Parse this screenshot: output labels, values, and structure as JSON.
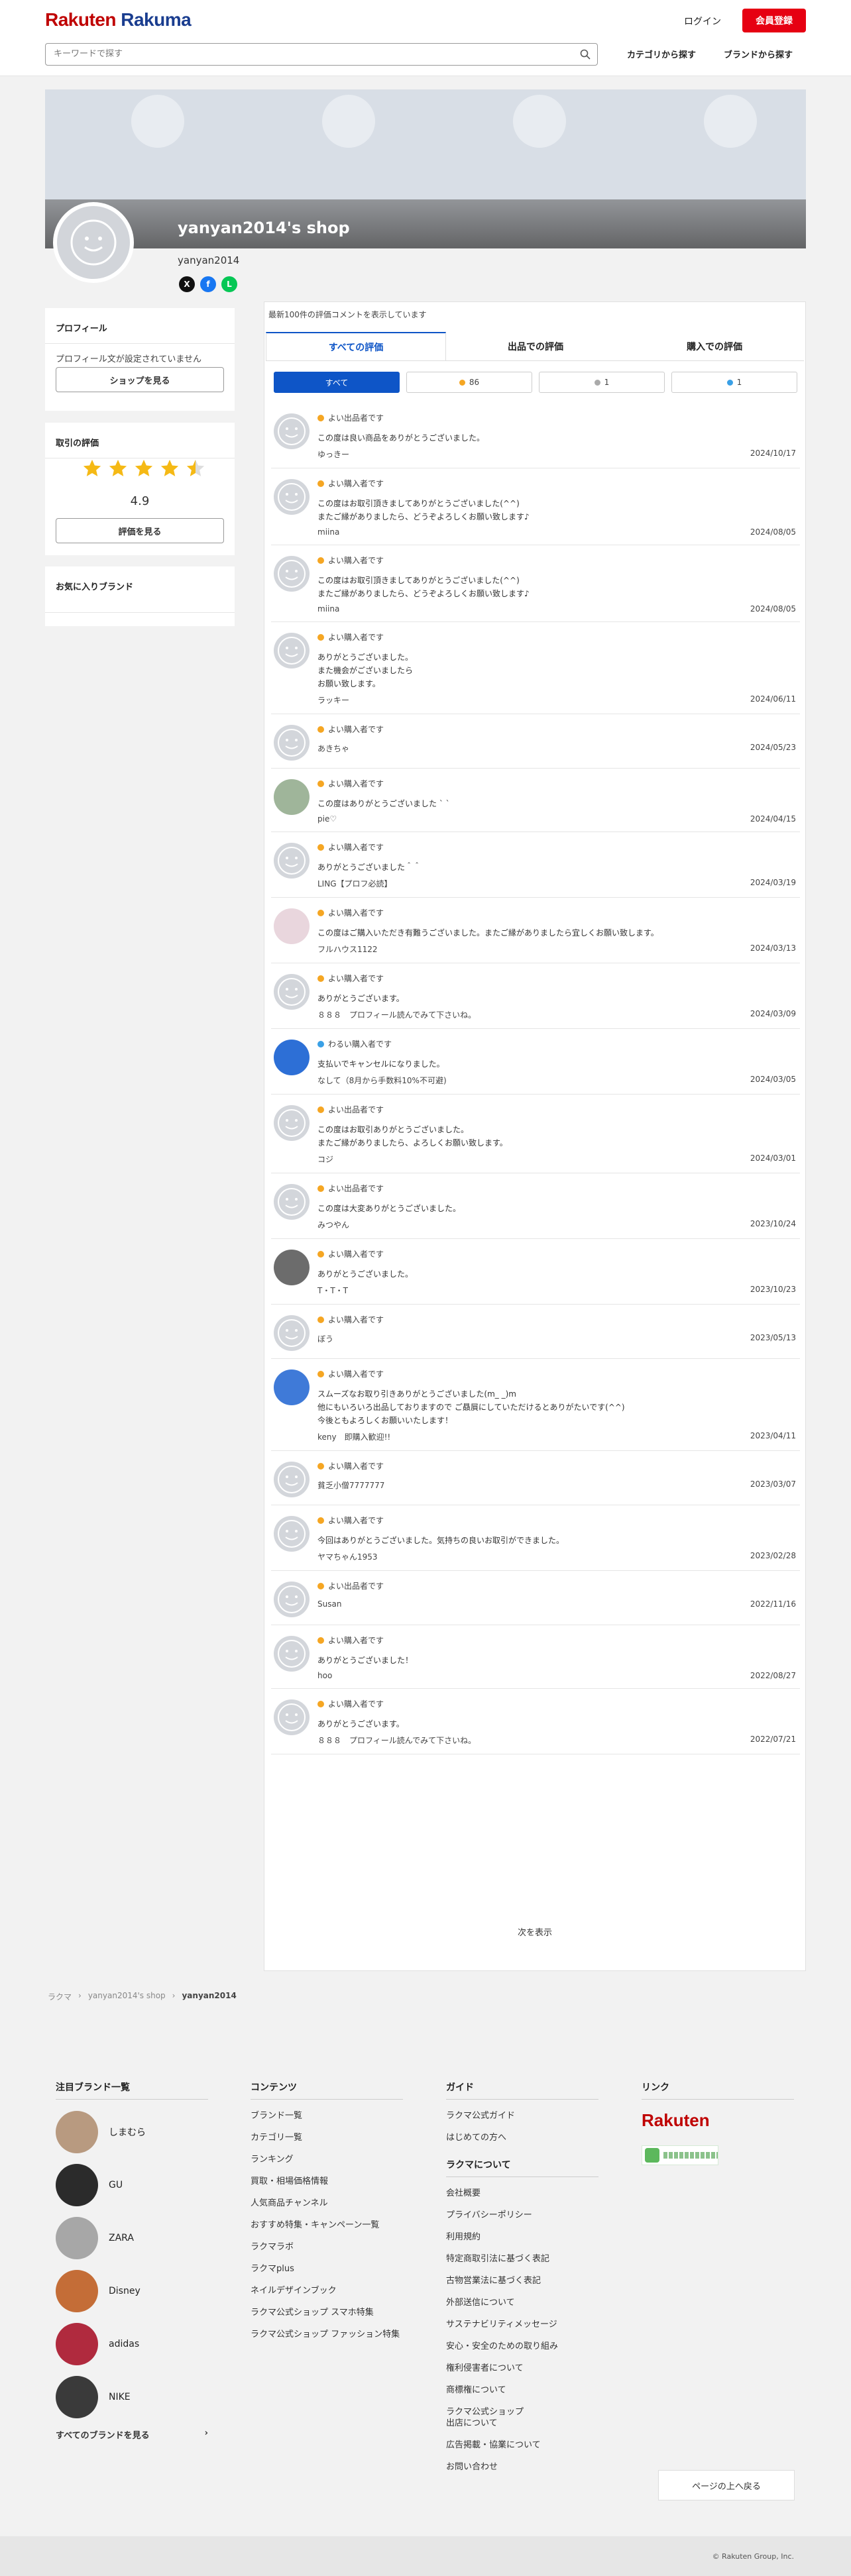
{
  "header": {
    "logo_rakuten": "Rakuten",
    "logo_rakuma": "Rakuma",
    "login": "ログイン",
    "signup": "会員登録",
    "search_placeholder": "キーワードで探す",
    "nav_category": "カテゴリから探す",
    "nav_brand": "ブランドから探す"
  },
  "shop": {
    "name": "yanyan2014's shop",
    "username": "yanyan2014"
  },
  "sidebar": {
    "profile_title": "プロフィール",
    "profile_text": "プロフィール文が設定されていません",
    "shop_button": "ショップを見る",
    "rating_title": "取引の評価",
    "rating_value": "4.9",
    "rating_stars": 4.5,
    "rating_button": "評価を見る",
    "fav_brand_title": "お気に入りブランド"
  },
  "main": {
    "note": "最新100件の評価コメントを表示しています",
    "tabs": [
      "すべての評価",
      "出品での評価",
      "購入での評価"
    ],
    "filters": {
      "all": "すべて",
      "good": "86",
      "normal": "1",
      "bad": "1"
    },
    "more": "次を表示"
  },
  "reviews": [
    {
      "type": "よい出品者です",
      "text": "この度は良い商品をありがとうございました。",
      "user": "ゆっきー",
      "date": "2024/10/17",
      "kind": "good"
    },
    {
      "type": "よい購入者です",
      "text": "この度はお取引頂きましてありがとうございました(^^)\nまたご縁がありましたら、どうぞよろしくお願い致します♪",
      "user": "miina",
      "date": "2024/08/05",
      "kind": "good"
    },
    {
      "type": "よい購入者です",
      "text": "この度はお取引頂きましてありがとうございました(^^)\nまたご縁がありましたら、どうぞよろしくお願い致します♪",
      "user": "miina",
      "date": "2024/08/05",
      "kind": "good"
    },
    {
      "type": "よい購入者です",
      "text": "ありがとうございました。\nまた機会がございましたら\nお願い致します。",
      "user": "ラッキー",
      "date": "2024/06/11",
      "kind": "good"
    },
    {
      "type": "よい購入者です",
      "text": "",
      "user": "あきちゃ",
      "date": "2024/05/23",
      "kind": "good"
    },
    {
      "type": "よい購入者です",
      "text": "この度はありがとうございました ` `",
      "user": "pie♡",
      "date": "2024/04/15",
      "kind": "good"
    },
    {
      "type": "よい購入者です",
      "text": "ありがとうございました＾＾",
      "user": "LING【プロフ必読】",
      "date": "2024/03/19",
      "kind": "good"
    },
    {
      "type": "よい購入者です",
      "text": "この度はご購入いただき有難うございました。またご縁がありましたら宜しくお願い致します。",
      "user": "フルハウス1122",
      "date": "2024/03/13",
      "kind": "good"
    },
    {
      "type": "よい購入者です",
      "text": "ありがとうございます。",
      "user": "８８８　プロフィール読んでみて下さいね。",
      "date": "2024/03/09",
      "kind": "good"
    },
    {
      "type": "わるい購入者です",
      "text": "支払いでキャンセルになりました。",
      "user": "なして（8月から手数料10%不可避)",
      "date": "2024/03/05",
      "kind": "bad"
    },
    {
      "type": "よい出品者です",
      "text": "この度はお取引ありがとうございました。\nまたご縁がありましたら、よろしくお願い致します。",
      "user": "コジ",
      "date": "2024/03/01",
      "kind": "good"
    },
    {
      "type": "よい出品者です",
      "text": "この度は大変ありがとうございました。",
      "user": "みつやん",
      "date": "2023/10/24",
      "kind": "good"
    },
    {
      "type": "よい購入者です",
      "text": "ありがとうございました。",
      "user": "T・T・T",
      "date": "2023/10/23",
      "kind": "good"
    },
    {
      "type": "よい購入者です",
      "text": "",
      "user": "ぼう",
      "date": "2023/05/13",
      "kind": "good"
    },
    {
      "type": "よい購入者です",
      "text": "スムーズなお取り引きありがとうございました(m_ _)m\n他にもいろいろ出品しておりますので ご贔屓にしていただけるとありがたいです(^^)\n今後ともよろしくお願いいたします！",
      "user": "keny　即購入歓迎!!",
      "date": "2023/04/11",
      "kind": "good"
    },
    {
      "type": "よい購入者です",
      "text": "",
      "user": "貧乏小僧7777777",
      "date": "2023/03/07",
      "kind": "good"
    },
    {
      "type": "よい購入者です",
      "text": "今回はありがとうございました。気持ちの良いお取引ができました。",
      "user": "ヤマちゃん1953",
      "date": "2023/02/28",
      "kind": "good"
    },
    {
      "type": "よい出品者です",
      "text": "",
      "user": "Susan",
      "date": "2022/11/16",
      "kind": "good"
    },
    {
      "type": "よい購入者です",
      "text": "ありがとうございました！",
      "user": "hoo",
      "date": "2022/08/27",
      "kind": "good"
    },
    {
      "type": "よい購入者です",
      "text": "ありがとうございます。",
      "user": "８８８　プロフィール読んでみて下さいね。",
      "date": "2022/07/21",
      "kind": "good"
    }
  ],
  "breadcrumb": [
    "ラクマ",
    "yanyan2014's shop",
    "yanyan2014"
  ],
  "footer": {
    "brands_title": "注目ブランド一覧",
    "brands": [
      "しまむら",
      "GU",
      "ZARA",
      "Disney",
      "adidas",
      "NIKE"
    ],
    "all_brands": "すべてのブランドを見る",
    "contents_title": "コンテンツ",
    "contents": [
      "ブランド一覧",
      "カテゴリ一覧",
      "ランキング",
      "買取・相場価格情報",
      "人気商品チャンネル",
      "おすすめ特集・キャンペーン一覧",
      "ラクマラボ",
      "ラクマplus",
      "ネイルデザインブック",
      "ラクマ公式ショップ スマホ特集",
      "ラクマ公式ショップ ファッション特集"
    ],
    "guide_title": "ガイド",
    "guide": [
      "ラクマ公式ガイド",
      "はじめての方へ"
    ],
    "about_title": "ラクマについて",
    "about": [
      "会社概要",
      "プライバシーポリシー",
      "利用規約",
      "特定商取引法に基づく表記",
      "古物営業法に基づく表記",
      "外部送信について",
      "サステナビリティメッセージ",
      "安心・安全のための取り組み",
      "権利侵害者について",
      "商標権について",
      "ラクマ公式ショップ\n出店について",
      "広告掲載・協業について",
      "お問い合わせ"
    ],
    "links_title": "リンク",
    "rakuten_logo": "Rakuten",
    "top_button": "ページの上へ戻る",
    "copyright": "© Rakuten Group, Inc."
  },
  "colors": {
    "accent": "#0e55c7",
    "brand_red": "#e60012",
    "star": "#f5b915"
  }
}
